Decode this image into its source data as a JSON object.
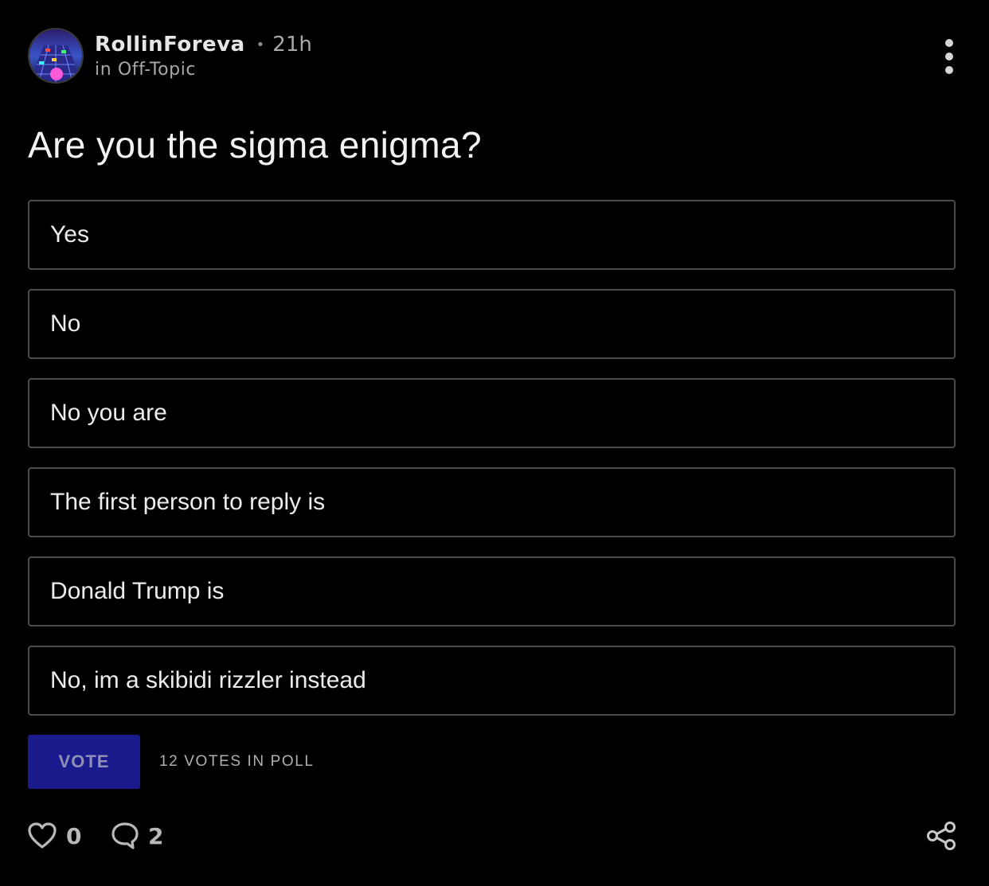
{
  "post": {
    "author": "RollinForeva",
    "separator": "•",
    "time": "21h",
    "community": "in Off-Topic",
    "title": "Are you the sigma enigma?"
  },
  "poll": {
    "options": [
      "Yes",
      "No",
      "No you are",
      "The first person to reply is",
      "Donald Trump is",
      "No, im a skibidi rizzler instead"
    ],
    "vote_label": "VOTE",
    "votes_text": "12 VOTES IN POLL"
  },
  "actions": {
    "likes": "0",
    "comments": "2"
  },
  "icons": {
    "more": "more-vertical-icon",
    "like": "heart-icon",
    "comment": "comment-bubble-icon",
    "share": "share-icon"
  },
  "colors": {
    "background": "#000000",
    "vote_button": "#1a1a8c",
    "option_border": "#4a4a4a"
  }
}
